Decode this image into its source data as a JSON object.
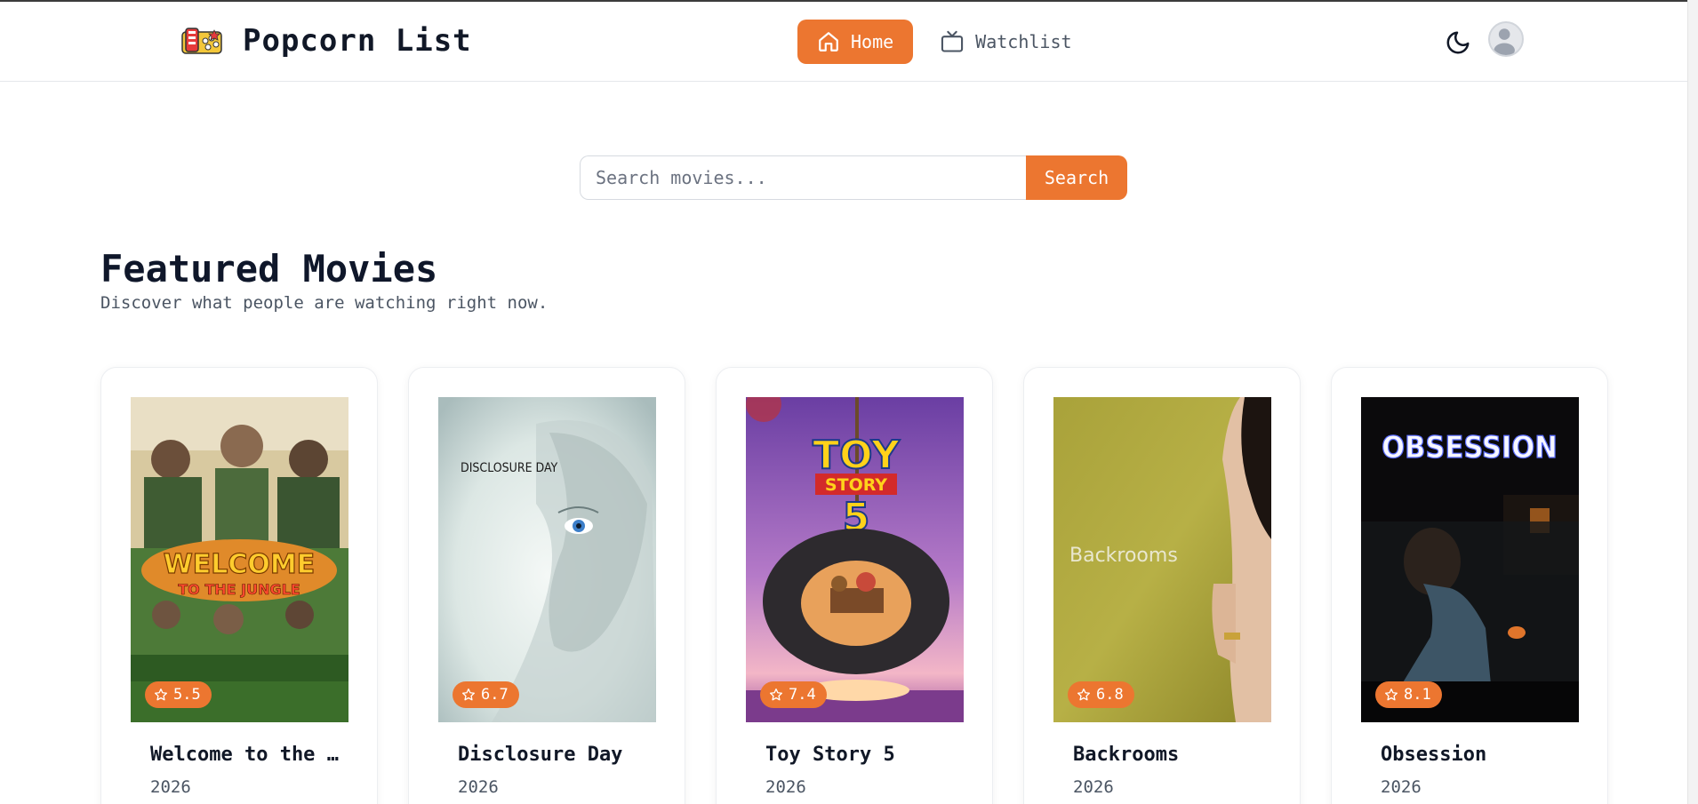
{
  "app": {
    "title": "Popcorn List"
  },
  "nav": {
    "home_label": "Home",
    "watchlist_label": "Watchlist"
  },
  "search": {
    "placeholder": "Search movies...",
    "value": "",
    "button_label": "Search"
  },
  "featured": {
    "title": "Featured Movies",
    "subtitle": "Discover what people are watching right now."
  },
  "movies": [
    {
      "title": "Welcome to the Jungle",
      "year": "2026",
      "rating": "5.5",
      "poster_text": [
        "WELCOME",
        "TO THE JUNGLE"
      ]
    },
    {
      "title": "Disclosure Day",
      "year": "2026",
      "rating": "6.7",
      "poster_text": [
        "DISCLOSURE DAY"
      ]
    },
    {
      "title": "Toy Story 5",
      "year": "2026",
      "rating": "7.4",
      "poster_text": [
        "TOY",
        "STORY",
        "5"
      ]
    },
    {
      "title": "Backrooms",
      "year": "2026",
      "rating": "6.8",
      "poster_text": [
        "Backrooms"
      ]
    },
    {
      "title": "Obsession",
      "year": "2026",
      "rating": "8.1",
      "poster_text": [
        "OBSESSION"
      ]
    }
  ],
  "colors": {
    "accent": "#ec7630",
    "text": "#111827",
    "muted": "#4b5563"
  },
  "icons": {
    "logo": "popcorn-ticket-icon",
    "home": "home-icon",
    "watchlist": "tv-icon",
    "theme": "moon-icon",
    "rating": "star-icon"
  }
}
